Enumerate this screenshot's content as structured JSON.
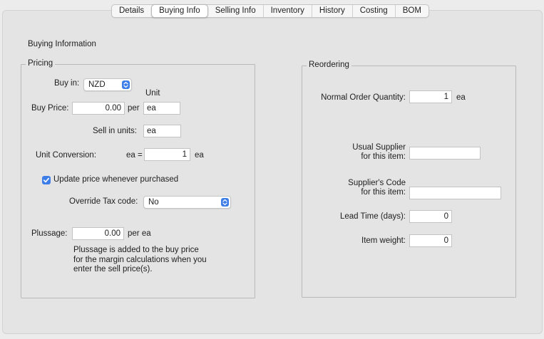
{
  "tabs": [
    {
      "label": "Details",
      "active": false
    },
    {
      "label": "Buying Info",
      "active": true
    },
    {
      "label": "Selling Info",
      "active": false
    },
    {
      "label": "Inventory",
      "active": false
    },
    {
      "label": "History",
      "active": false
    },
    {
      "label": "Costing",
      "active": false
    },
    {
      "label": "BOM",
      "active": false
    }
  ],
  "heading": "Buying Information",
  "pricing": {
    "legend": "Pricing",
    "buy_in_label": "Buy in:",
    "buy_in_value": "NZD",
    "unit_header": "Unit",
    "buy_price_label": "Buy Price:",
    "buy_price_value": "0.00",
    "per_label": "per",
    "buy_unit_value": "ea",
    "sell_in_units_label": "Sell in units:",
    "sell_in_units_value": "ea",
    "unit_conversion_label": "Unit Conversion:",
    "conversion_prefix": "ea =",
    "conversion_value": "1",
    "conversion_suffix": "ea",
    "update_price_label": "Update price whenever purchased",
    "update_price_checked": true,
    "override_tax_label": "Override Tax code:",
    "override_tax_value": "No",
    "plussage_label": "Plussage:",
    "plussage_value": "0.00",
    "plussage_suffix": "per ea",
    "plussage_note_lines": [
      "Plussage is added to the buy price",
      "for the margin calculations when you",
      "enter the sell price(s)."
    ]
  },
  "reordering": {
    "legend": "Reordering",
    "normal_order_qty_label": "Normal Order Quantity:",
    "normal_order_qty_value": "1",
    "normal_order_qty_unit": "ea",
    "usual_supplier_label_1": "Usual Supplier",
    "usual_supplier_label_2": "for this item:",
    "usual_supplier_value": "",
    "supplier_code_label_1": "Supplier's Code",
    "supplier_code_label_2": "for this item:",
    "supplier_code_value": "",
    "lead_time_label": "Lead Time (days):",
    "lead_time_value": "0",
    "item_weight_label": "Item weight:",
    "item_weight_value": "0"
  },
  "colors": {
    "accent": "#3d7de8",
    "panel": "#e4e4e4",
    "window": "#ececec"
  },
  "icons": {
    "select_stepper": "updown-chevron-icon",
    "checkbox": "checkmark-icon"
  }
}
